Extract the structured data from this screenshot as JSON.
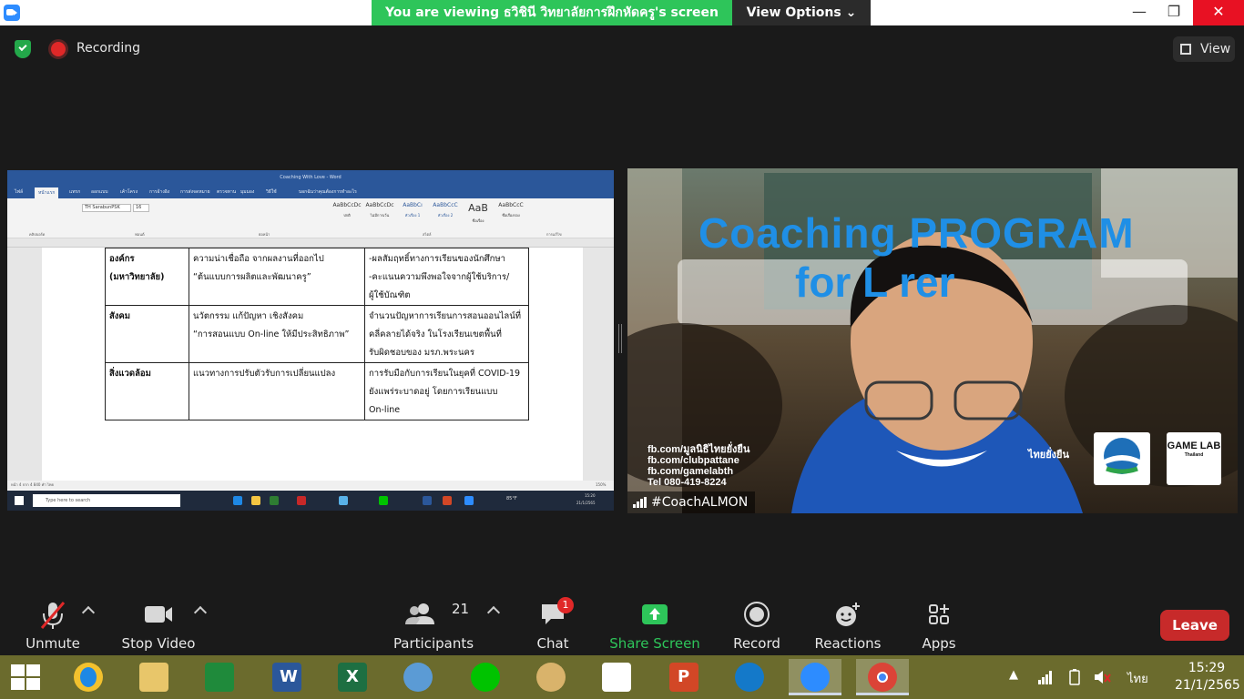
{
  "window": {
    "viewing_banner": "You are viewing ธวิชินี วิทยาลัยการฝึกหัดครู's screen",
    "view_options": "View Options",
    "minimize": "—",
    "maximize": "❐",
    "close": "✕"
  },
  "meeting_bar": {
    "recording": "Recording",
    "view": "View"
  },
  "shared_screen": {
    "word_title": "Coaching With Love - Word",
    "tabs": [
      "ไฟล์",
      "หน้าแรก",
      "แทรก",
      "ออกแบบ",
      "เค้าโครง",
      "การอ้างอิง",
      "การส่งจดหมาย",
      "ตรวจทาน",
      "มุมมอง",
      "วิธีใช้",
      "บอกฉันว่าคุณต้องการทำอะไร"
    ],
    "font_name": "TH SarabunPSK",
    "font_size": "16",
    "styles": [
      {
        "preview": "AaBbCcDc",
        "name": "ปกติ"
      },
      {
        "preview": "AaBbCcDc",
        "name": "ไม่มีการเว้น"
      },
      {
        "preview": "AaBbCı",
        "name": "หัวเรื่อง 1"
      },
      {
        "preview": "AaBbCcC",
        "name": "หัวเรื่อง 2"
      },
      {
        "preview": "AaB",
        "name": "ชื่อเรื่อง"
      },
      {
        "preview": "AaBbCcC",
        "name": "ชื่อเรื่องรอง"
      }
    ],
    "ribbon_groups": [
      "คลิปบอร์ด",
      "ฟอนต์",
      "ย่อหน้า",
      "สไตล์",
      "การแก้ไข"
    ],
    "table_rows": [
      {
        "col1": [
          "องค์กร",
          "(มหาวิทยาลัย)"
        ],
        "col2": [
          "ความน่าเชื่อถือ จากผลงานที่ออกไป",
          "“ต้นแบบการผลิตและพัฒนาครู”"
        ],
        "col3": [
          "-ผลสัมฤทธิ์ทางการเรียนของนักศึกษา",
          "-คะแนนความพึงพอใจจากผู้ใช้บริการ/",
          "ผู้ใช้บัณฑิต"
        ]
      },
      {
        "col1": [
          "สังคม"
        ],
        "col2": [
          "นวัตกรรม  แก้ปัญหา เชิงสังคม",
          "“การสอนแบบ  On-line ให้มีประสิทธิภาพ”"
        ],
        "col3": [
          "จำนวนปัญหาการเรียนการสอนออนไลน์ที่",
          "คลี่คลายได้จริง  ในโรงเรียนเขตพื้นที่",
          "รับผิดชอบของ มรภ.พระนคร"
        ]
      },
      {
        "col1": [
          "สิ่งแวดล้อม"
        ],
        "col2": [
          "แนวทางการปรับตัวรับการเปลี่ยนแปลง"
        ],
        "col3": [
          "การรับมือกับการเรียนในยุคที่  COVID-19",
          "ยังแพร่ระบาดอยู่  โดยการเรียนแบบ",
          "On-line"
        ]
      }
    ],
    "status_text": "หน้า 4 จาก 4    840 คำ    ไทย",
    "search_placeholder": "Type here to search",
    "tray_weather": "85°F",
    "tray_time": "15:20",
    "tray_date": "21/1/2565",
    "zoom_level": "150%"
  },
  "video": {
    "title_line1": "Coaching PROGRAM",
    "title_line2": "for L   rer",
    "fb_lines": [
      "fb.com/มูลนิธิไทยยั่งยืน",
      "fb.com/clubpattane",
      "fb.com/gamelabth",
      "Tel 080-419-8224"
    ],
    "game_lab": "GAME LAB",
    "game_lab_sub": "Thailand",
    "partner_text": "ไทยยั่งยืน",
    "participant_name": "#CoachALMON"
  },
  "toolbar": {
    "unmute": "Unmute",
    "stop_video": "Stop Video",
    "participants": "Participants",
    "participants_count": "21",
    "chat": "Chat",
    "chat_badge": "1",
    "share_screen": "Share Screen",
    "record": "Record",
    "reactions": "Reactions",
    "apps": "Apps",
    "leave": "Leave"
  },
  "taskbar": {
    "language": "ไทย",
    "time": "15:29",
    "date": "21/1/2565"
  },
  "colors": {
    "share_green": "#2ec55a",
    "zoom_blue": "#2d8cff",
    "leave_red": "#c72a2a",
    "taskbar": "#6b6b2d"
  }
}
